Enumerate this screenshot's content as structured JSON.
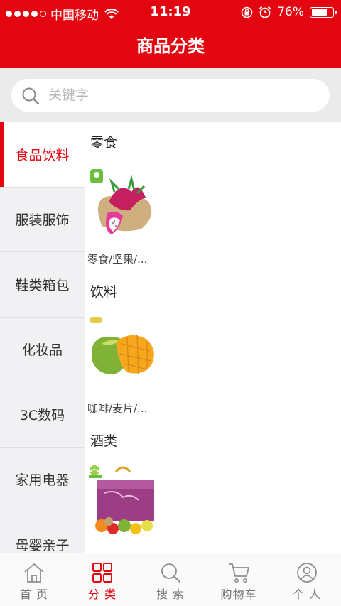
{
  "status_bar": {
    "carrier": "中国移动",
    "time": "11:19",
    "battery": "76%",
    "battery_level": 0.76
  },
  "header": {
    "title": "商品分类"
  },
  "search": {
    "placeholder": "关键字"
  },
  "sidebar": {
    "items": [
      {
        "label": "食品饮料",
        "active": true
      },
      {
        "label": "服装服饰"
      },
      {
        "label": "鞋类箱包"
      },
      {
        "label": "化妆品"
      },
      {
        "label": "3C数码"
      },
      {
        "label": "家用电器"
      },
      {
        "label": "母婴亲子"
      }
    ]
  },
  "sections": [
    {
      "title": "零食",
      "product_label": "零食/坚果/...",
      "image_icon": "dragon-fruit"
    },
    {
      "title": "饮料",
      "product_label": "咖啡/麦片/...",
      "image_icon": "mango"
    },
    {
      "title": "酒类",
      "product_label": "",
      "image_icon": "fruit-gift-box"
    }
  ],
  "tab_bar": {
    "tabs": [
      {
        "label": "首 页",
        "icon": "home-icon"
      },
      {
        "label": "分 类",
        "icon": "grid-icon",
        "active": true
      },
      {
        "label": "搜 索",
        "icon": "search-icon"
      },
      {
        "label": "购物车",
        "icon": "cart-icon"
      },
      {
        "label": "个 人",
        "icon": "user-icon"
      }
    ]
  },
  "colors": {
    "brand": "#e3050f",
    "sidebar_bg": "#f1f1f3",
    "search_bg": "#ebebec"
  }
}
